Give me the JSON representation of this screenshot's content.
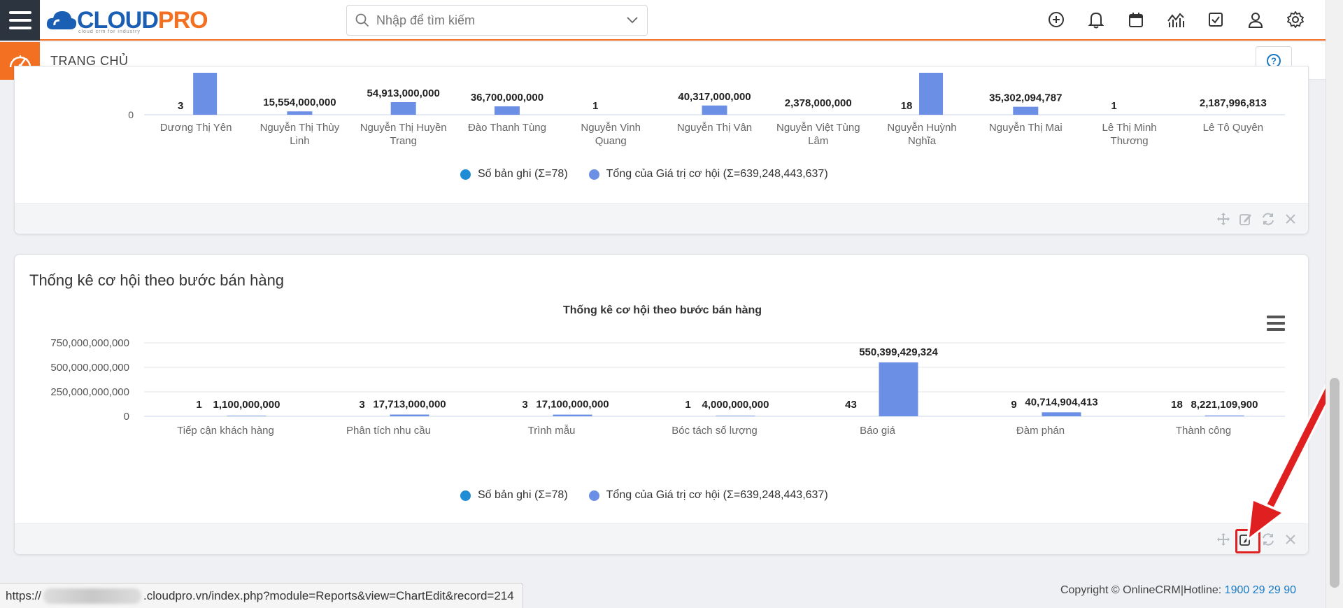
{
  "header": {
    "logo_text_a": "CLOUD",
    "logo_text_b": "PRO",
    "logo_tagline": "cloud crm for industry",
    "search_placeholder": "Nhập để tìm kiếm",
    "page_title": "TRANG CHỦ"
  },
  "panel_top": {
    "chart_data": {
      "type": "bar",
      "categories": [
        "Dương Thị Yên",
        "Nguyễn Thị Thùy Linh",
        "Nguyễn Thị Huyền Trang",
        "Đào Thanh Tùng",
        "Nguyễn Vinh Quang",
        "Nguyễn Thị Vân",
        "Nguyễn Việt Tùng Lâm",
        "Nguyễn Huỳnh Nghĩa",
        "Nguyễn Thị Mai",
        "Lê Thị Minh Thương",
        "Lê Tô Quyên"
      ],
      "category_lines": [
        [
          "Dương Thị Yên"
        ],
        [
          "Nguyễn Thị Thùy",
          "Linh"
        ],
        [
          "Nguyễn Thị Huyền",
          "Trang"
        ],
        [
          "Đào Thanh Tùng"
        ],
        [
          "Nguyễn Vinh",
          "Quang"
        ],
        [
          "Nguyễn Thị Vân"
        ],
        [
          "Nguyễn Việt Tùng",
          "Lâm"
        ],
        [
          "Nguyễn Huỳnh",
          "Nghĩa"
        ],
        [
          "Nguyễn Thị Mai"
        ],
        [
          "Lê Thị Minh",
          "Thương"
        ],
        [
          "Lê Tô Quyên"
        ]
      ],
      "series": [
        {
          "name": "Số bản ghi",
          "values": [
            3,
            null,
            null,
            null,
            1,
            null,
            null,
            18,
            null,
            1,
            null
          ],
          "labels": [
            "3",
            "",
            "",
            "",
            "1",
            "",
            "",
            "18",
            "",
            "1",
            ""
          ]
        },
        {
          "name": "Tổng của Giá trị cơ hội",
          "values": [
            null,
            15554000000,
            54913000000,
            36700000000,
            null,
            40317000000,
            2378000000,
            null,
            35302094787,
            null,
            2187996813
          ],
          "labels": [
            "",
            "15,554,000,000",
            "54,913,000,000",
            "36,700,000,000",
            "",
            "40,317,000,000",
            "2,378,000,000",
            "",
            "35,302,094,787",
            "",
            "2,187,996,813"
          ]
        }
      ],
      "bar_level": [
        1.0,
        0.08,
        0.3,
        0.2,
        0,
        0.22,
        0,
        1.0,
        0.19,
        0,
        0
      ],
      "y_zero_label": "0",
      "legend": [
        "Số bản ghi (Σ=78)",
        "Tổng của Giá trị cơ hội (Σ=639,248,443,637)"
      ]
    }
  },
  "panel_bottom": {
    "title": "Thống kê cơ hội theo bước bán hàng",
    "chart_data": {
      "type": "bar",
      "title": "Thống kê cơ hội theo bước bán hàng",
      "categories": [
        "Tiếp cận khách hàng",
        "Phân tích nhu cầu",
        "Trình mẫu",
        "Bóc tách số lượng",
        "Báo giá",
        "Đàm phán",
        "Thành công"
      ],
      "series": [
        {
          "name": "Số bản ghi",
          "values": [
            1,
            3,
            3,
            1,
            43,
            9,
            18
          ],
          "labels": [
            "1",
            "3",
            "3",
            "1",
            "43",
            "9",
            "18"
          ]
        },
        {
          "name": "Tổng của Giá trị cơ hội",
          "values": [
            1100000000,
            17713000000,
            17100000000,
            4000000000,
            550399429324,
            40714904413,
            8221109900
          ],
          "labels": [
            "1,100,000,000",
            "17,713,000,000",
            "17,100,000,000",
            "4,000,000,000",
            "550,399,429,324",
            "40,714,904,413",
            "8,221,109,900"
          ]
        }
      ],
      "y_ticks": [
        "750,000,000,000",
        "500,000,000,000",
        "250,000,000,000",
        "0"
      ],
      "ylim": [
        0,
        750000000000
      ],
      "legend": [
        "Số bản ghi (Σ=78)",
        "Tổng của Giá trị cơ hội (Σ=639,248,443,637)"
      ]
    }
  },
  "colors": {
    "series_count": "#1f8dd6",
    "series_value": "#6b8fe4",
    "accent": "#f36f21",
    "highlight": "#e02020"
  },
  "footer": {
    "copyright": "Copyright © OnlineCRM|Hotline:",
    "hotline": "1900 29 29 90",
    "status_url_prefix": "https://",
    "status_url_suffix": ".cloudpro.vn/index.php?module=Reports&view=ChartEdit&record=214"
  }
}
